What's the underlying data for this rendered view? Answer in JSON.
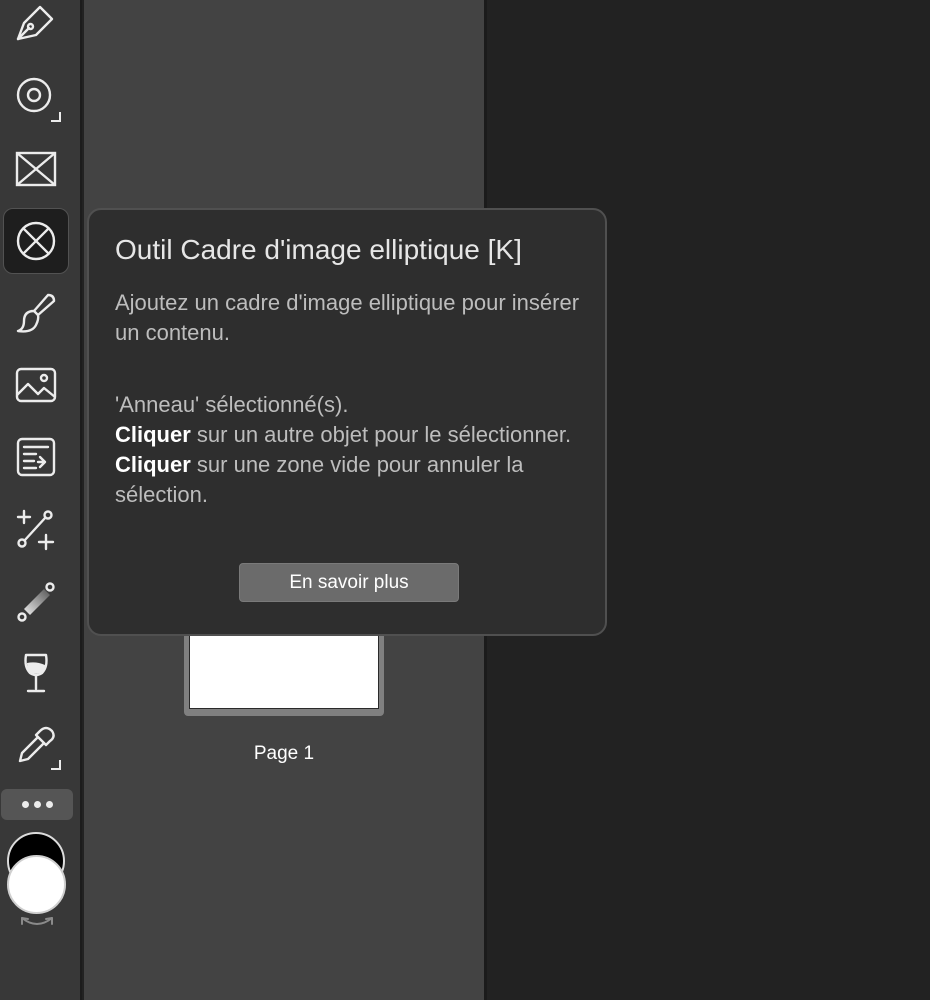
{
  "tooltip": {
    "title": "Outil Cadre d'image elliptique [K]",
    "description": "Ajoutez un cadre d'image elliptique pour insérer un contenu.",
    "status_selected": "'Anneau' sélectionné(s).",
    "hint1_key": "Cliquer",
    "hint1_rest": " sur un autre objet pour le sélectionner.",
    "hint2_key": "Cliquer",
    "hint2_rest": " sur une zone vide pour annuler la sélection.",
    "learn_more_label": "En savoir plus"
  },
  "pages_panel": {
    "page_label": "Page 1"
  },
  "toolbar": {
    "tools": [
      "pen-icon",
      "ring-icon",
      "rectangle-frame-icon",
      "ellipse-frame-icon",
      "brush-icon",
      "image-icon",
      "text-frame-icon",
      "node-add-icon",
      "gradient-icon",
      "transparency-icon",
      "eyedropper-icon"
    ],
    "active_tool": "ellipse-frame-icon",
    "stroke_color": "#000000",
    "fill_color": "#ffffff"
  }
}
